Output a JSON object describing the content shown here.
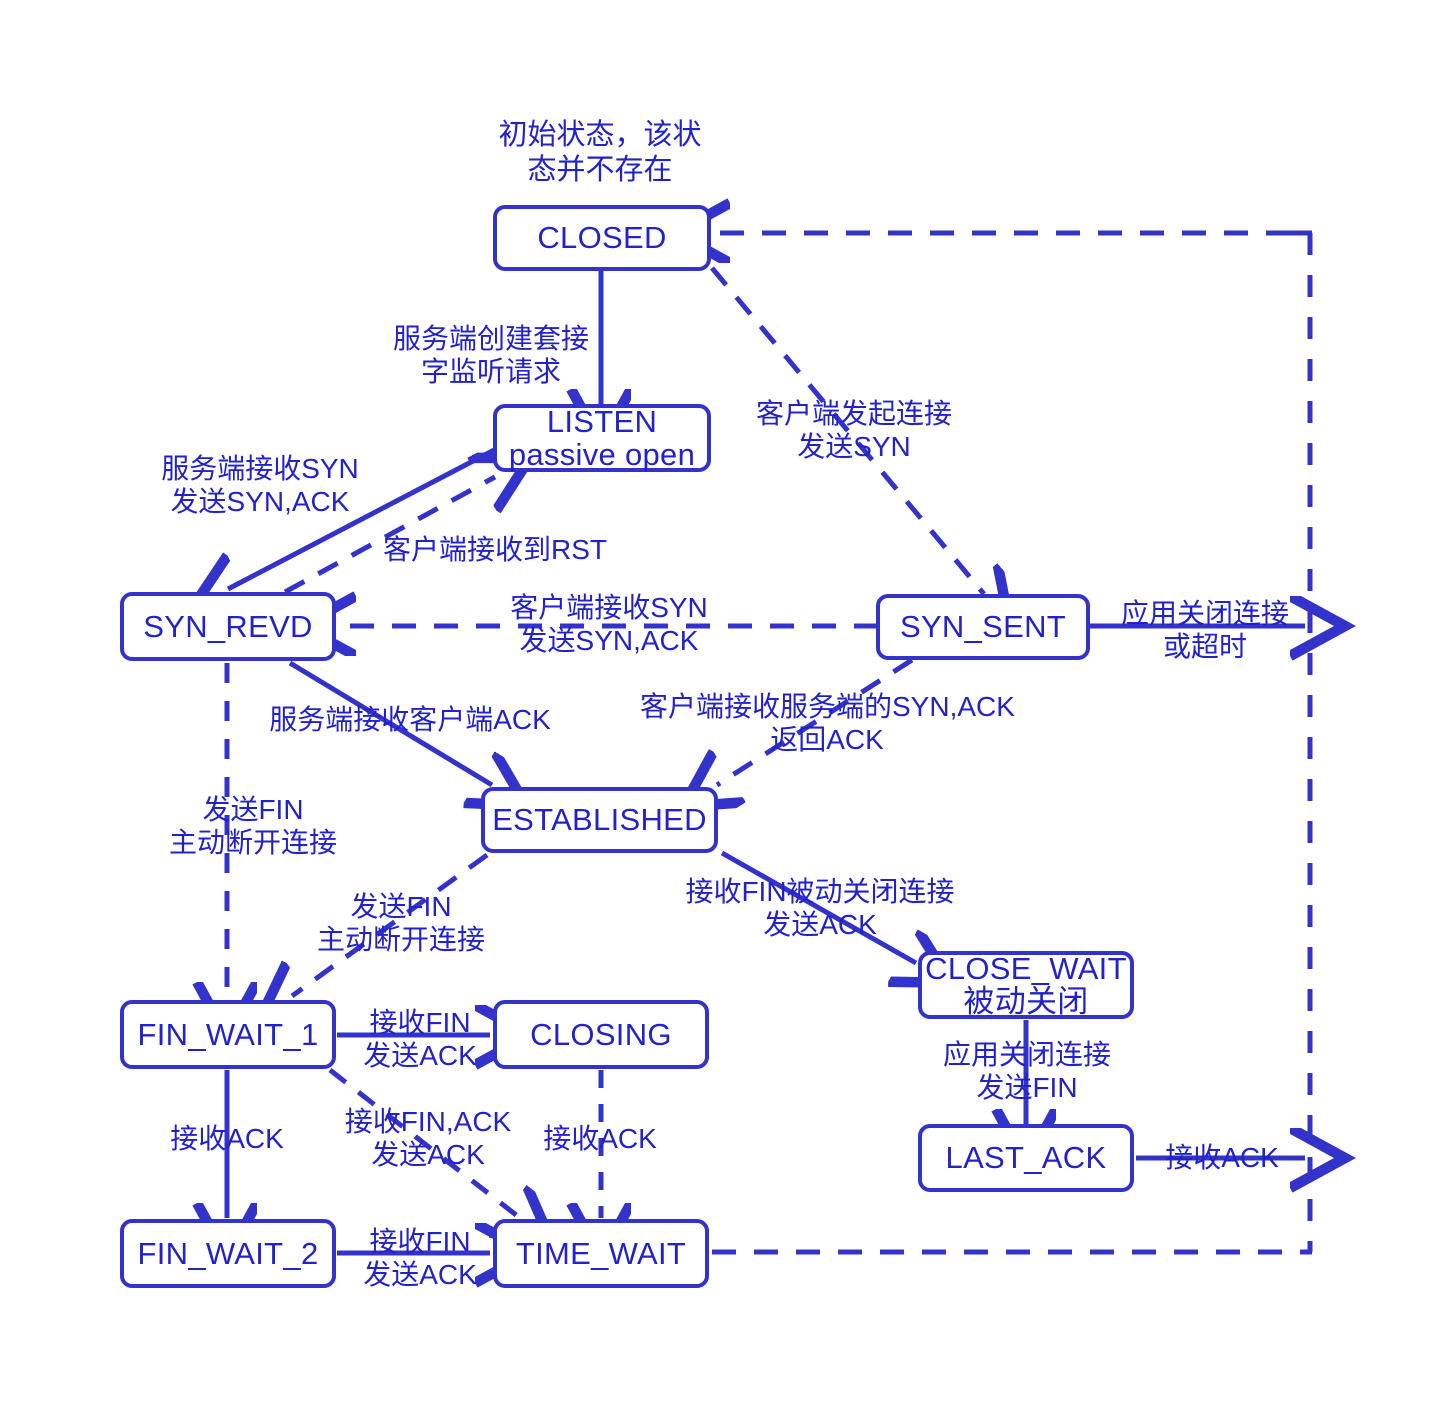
{
  "diagram": {
    "title": "TCP 状态转换图",
    "accent_color": "#3333cc",
    "text_color": "#2222cc",
    "background": "#ffffff"
  },
  "notes": [
    {
      "id": "closed-note",
      "line1": "初始状态，该状",
      "line2": "态并不存在"
    }
  ],
  "states": [
    {
      "id": "closed",
      "name": "CLOSED",
      "sub": ""
    },
    {
      "id": "listen",
      "name": "LISTEN",
      "sub": "passive open"
    },
    {
      "id": "syn_revd",
      "name": "SYN_REVD",
      "sub": ""
    },
    {
      "id": "syn_sent",
      "name": "SYN_SENT",
      "sub": ""
    },
    {
      "id": "established",
      "name": "ESTABLISHED",
      "sub": ""
    },
    {
      "id": "close_wait",
      "name": "CLOSE_WAIT",
      "sub": "被动关闭"
    },
    {
      "id": "last_ack",
      "name": "LAST_ACK",
      "sub": ""
    },
    {
      "id": "fin_wait_1",
      "name": "FIN_WAIT_1",
      "sub": ""
    },
    {
      "id": "closing",
      "name": "CLOSING",
      "sub": ""
    },
    {
      "id": "fin_wait_2",
      "name": "FIN_WAIT_2",
      "sub": ""
    },
    {
      "id": "time_wait",
      "name": "TIME_WAIT",
      "sub": ""
    }
  ],
  "transitions": [
    {
      "id": "closed-to-listen",
      "from": "CLOSED",
      "to": "LISTEN",
      "style": "solid",
      "line1": "服务端创建套接",
      "line2": "字监听请求"
    },
    {
      "id": "closed-to-synsent",
      "from": "CLOSED",
      "to": "SYN_SENT",
      "style": "dashed",
      "line1": "客户端发起连接",
      "line2": "发送SYN"
    },
    {
      "id": "listen-to-synrevd",
      "from": "LISTEN",
      "to": "SYN_REVD",
      "style": "solid",
      "line1": "服务端接收SYN",
      "line2": "发送SYN,ACK"
    },
    {
      "id": "synrevd-to-listen",
      "from": "SYN_REVD",
      "to": "LISTEN",
      "style": "dashed",
      "line1": "客户端接收到RST",
      "line2": ""
    },
    {
      "id": "synsent-to-synrevd",
      "from": "SYN_SENT",
      "to": "SYN_REVD",
      "style": "dashed",
      "line1": "客户端接收SYN",
      "line2": "发送SYN,ACK"
    },
    {
      "id": "synsent-to-closed",
      "from": "SYN_SENT",
      "to": "CLOSED",
      "style": "dashed",
      "line1": "应用关闭连接",
      "line2": "或超时"
    },
    {
      "id": "synrevd-to-established",
      "from": "SYN_REVD",
      "to": "ESTABLISHED",
      "style": "solid",
      "line1": "服务端接收客户端ACK",
      "line2": ""
    },
    {
      "id": "synsent-to-established",
      "from": "SYN_SENT",
      "to": "ESTABLISHED",
      "style": "dashed",
      "line1": "客户端接收服务端的SYN,ACK",
      "line2": "返回ACK"
    },
    {
      "id": "synrevd-to-finwait1",
      "from": "SYN_REVD",
      "to": "FIN_WAIT_1",
      "style": "dashed",
      "line1": "发送FIN",
      "line2": "主动断开连接"
    },
    {
      "id": "established-to-finwait1",
      "from": "ESTABLISHED",
      "to": "FIN_WAIT_1",
      "style": "dashed",
      "line1": "发送FIN",
      "line2": "主动断开连接"
    },
    {
      "id": "established-to-closewait",
      "from": "ESTABLISHED",
      "to": "CLOSE_WAIT",
      "style": "solid",
      "line1": "接收FIN被动关闭连接",
      "line2": "发送ACK"
    },
    {
      "id": "closewait-to-lastack",
      "from": "CLOSE_WAIT",
      "to": "LAST_ACK",
      "style": "solid",
      "line1": "应用关闭连接",
      "line2": "发送FIN"
    },
    {
      "id": "lastack-to-closed",
      "from": "LAST_ACK",
      "to": "CLOSED",
      "style": "solid",
      "line1": "接收ACK",
      "line2": ""
    },
    {
      "id": "finwait1-to-closing",
      "from": "FIN_WAIT_1",
      "to": "CLOSING",
      "style": "solid",
      "line1": "接收FIN",
      "line2": "发送ACK"
    },
    {
      "id": "finwait1-to-finwait2",
      "from": "FIN_WAIT_1",
      "to": "FIN_WAIT_2",
      "style": "dashed",
      "line1": "接收ACK",
      "line2": ""
    },
    {
      "id": "finwait1-to-timewait",
      "from": "FIN_WAIT_1",
      "to": "TIME_WAIT",
      "style": "dashed",
      "line1": "接收FIN,ACK",
      "line2": "发送ACK"
    },
    {
      "id": "closing-to-timewait",
      "from": "CLOSING",
      "to": "TIME_WAIT",
      "style": "dashed",
      "line1": "接收ACK",
      "line2": ""
    },
    {
      "id": "finwait2-to-timewait",
      "from": "FIN_WAIT_2",
      "to": "TIME_WAIT",
      "style": "solid",
      "line1": "接收FIN",
      "line2": "发送ACK"
    },
    {
      "id": "timewait-to-closed",
      "from": "TIME_WAIT",
      "to": "CLOSED",
      "style": "dashed",
      "line1": "",
      "line2": ""
    }
  ]
}
